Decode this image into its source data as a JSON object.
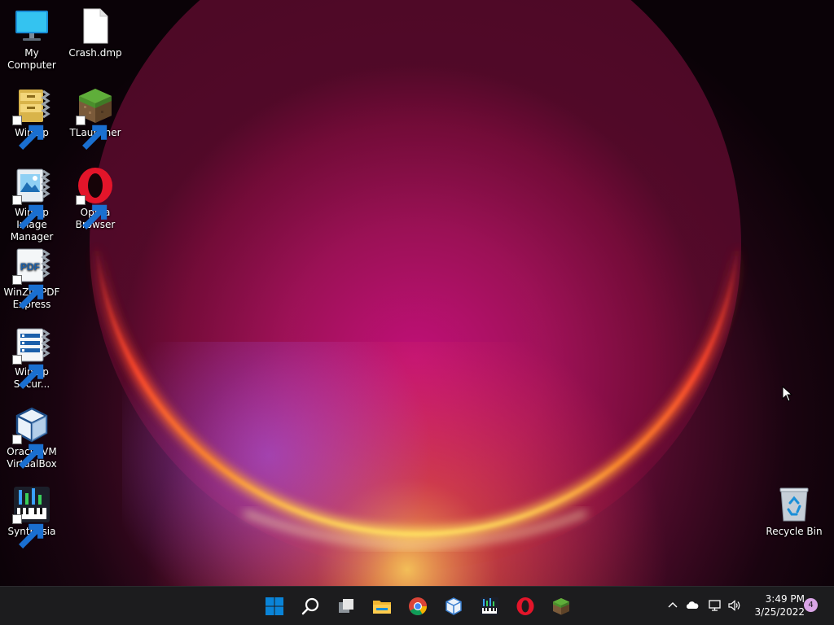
{
  "desktop": {
    "icons": [
      {
        "label": "My Computer",
        "icon": "monitor-icon"
      },
      {
        "label": "Crash.dmp",
        "icon": "blank-file-icon"
      },
      {
        "label": "WinZip",
        "icon": "winzip-icon"
      },
      {
        "label": "TLauncher",
        "icon": "grass-block-icon"
      },
      {
        "label": "WinZip Image Manager",
        "icon": "winzip-image-icon"
      },
      {
        "label": "Opera Browser",
        "icon": "opera-icon"
      },
      {
        "label": "WinZip PDF Express",
        "icon": "winzip-pdf-icon"
      },
      {
        "label": "WinZip Secur...",
        "icon": "winzip-secure-icon"
      },
      {
        "label": "Oracle VM VirtualBox",
        "icon": "virtualbox-icon"
      },
      {
        "label": "Synthesia",
        "icon": "synthesia-icon"
      },
      {
        "label": "Recycle Bin",
        "icon": "recycle-bin-icon"
      }
    ]
  },
  "taskbar": {
    "apps": [
      {
        "name": "Start",
        "icon": "windows-start-icon"
      },
      {
        "name": "Search",
        "icon": "search-icon"
      },
      {
        "name": "Task View",
        "icon": "task-view-icon"
      },
      {
        "name": "File Explorer",
        "icon": "folder-icon"
      },
      {
        "name": "Google Chrome",
        "icon": "chrome-icon"
      },
      {
        "name": "Oracle VM VirtualBox",
        "icon": "virtualbox-icon"
      },
      {
        "name": "Synthesia",
        "icon": "synthesia-icon"
      },
      {
        "name": "Opera",
        "icon": "opera-icon"
      },
      {
        "name": "TLauncher",
        "icon": "grass-block-icon"
      }
    ],
    "tray": {
      "icons": [
        "chevron-up-icon",
        "cloud-icon",
        "network-icon",
        "speaker-icon"
      ],
      "time": "3:49 PM",
      "date": "3/25/2022",
      "notification_count": "4"
    }
  },
  "colors": {
    "taskbar_bg": "#1c1c1e",
    "windows_blue": "#0a84d8",
    "opera_red": "#e3152a",
    "notification_badge": "#d9a5e6"
  }
}
